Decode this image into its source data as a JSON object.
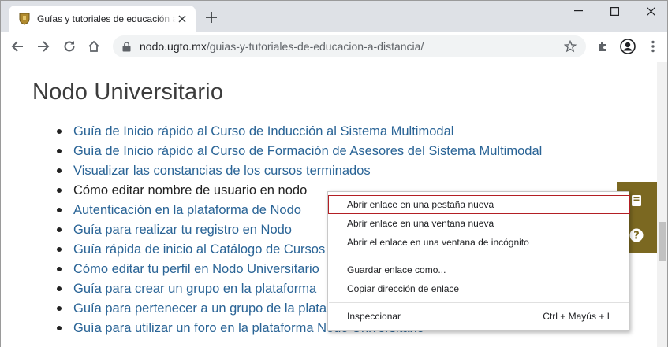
{
  "tab": {
    "title": "Guías y tutoriales de educación a distancia"
  },
  "address_bar": {
    "domain": "nodo.ugto.mx",
    "path": "/guias-y-tutoriales-de-educacion-a-distancia/"
  },
  "page": {
    "heading": "Nodo Universitario",
    "links": [
      {
        "text": "Guía de Inicio rápido al Curso de Inducción al Sistema Multimodal",
        "is_link": true
      },
      {
        "text": "Guía de Inicio rápido al Curso de Formación de Asesores del Sistema Multimodal",
        "is_link": true
      },
      {
        "text": "Visualizar las constancias de los cursos terminados",
        "is_link": true
      },
      {
        "text": "Cómo editar nombre de usuario en nodo",
        "is_link": false
      },
      {
        "text": "Autenticación en la plataforma de Nodo",
        "is_link": true
      },
      {
        "text": "Guía para realizar tu registro en Nodo",
        "is_link": true
      },
      {
        "text": "Guía rápida de inicio al Catálogo de Cursos",
        "is_link": true
      },
      {
        "text": "Cómo editar tu perfil en Nodo Universitario",
        "is_link": true
      },
      {
        "text": "Guía para crear un grupo en la plataforma",
        "is_link": true
      },
      {
        "text": "Guía para pertenecer a un grupo de la plataforma",
        "is_link": true
      },
      {
        "text": "Guía para utilizar un foro en la plataforma Nodo Universitario",
        "is_link": true
      }
    ]
  },
  "context_menu": {
    "items": [
      {
        "label": "Abrir enlace en una pestaña nueva",
        "shortcut": ""
      },
      {
        "label": "Abrir enlace en una ventana nueva",
        "shortcut": ""
      },
      {
        "label": "Abrir el enlace en una ventana de incógnito",
        "shortcut": ""
      },
      {
        "label": "Guardar enlace como...",
        "shortcut": ""
      },
      {
        "label": "Copiar dirección de enlace",
        "shortcut": ""
      },
      {
        "label": "Inspeccionar",
        "shortcut": "Ctrl + Mayús + I"
      }
    ]
  },
  "icons": {
    "favicon": "ugto-crest-icon",
    "side_widget": [
      "book-icon",
      "help-icon"
    ]
  },
  "colors": {
    "link": "#2a6496",
    "widget": "#7b6821",
    "menu_highlight_border": "#b31f24"
  }
}
